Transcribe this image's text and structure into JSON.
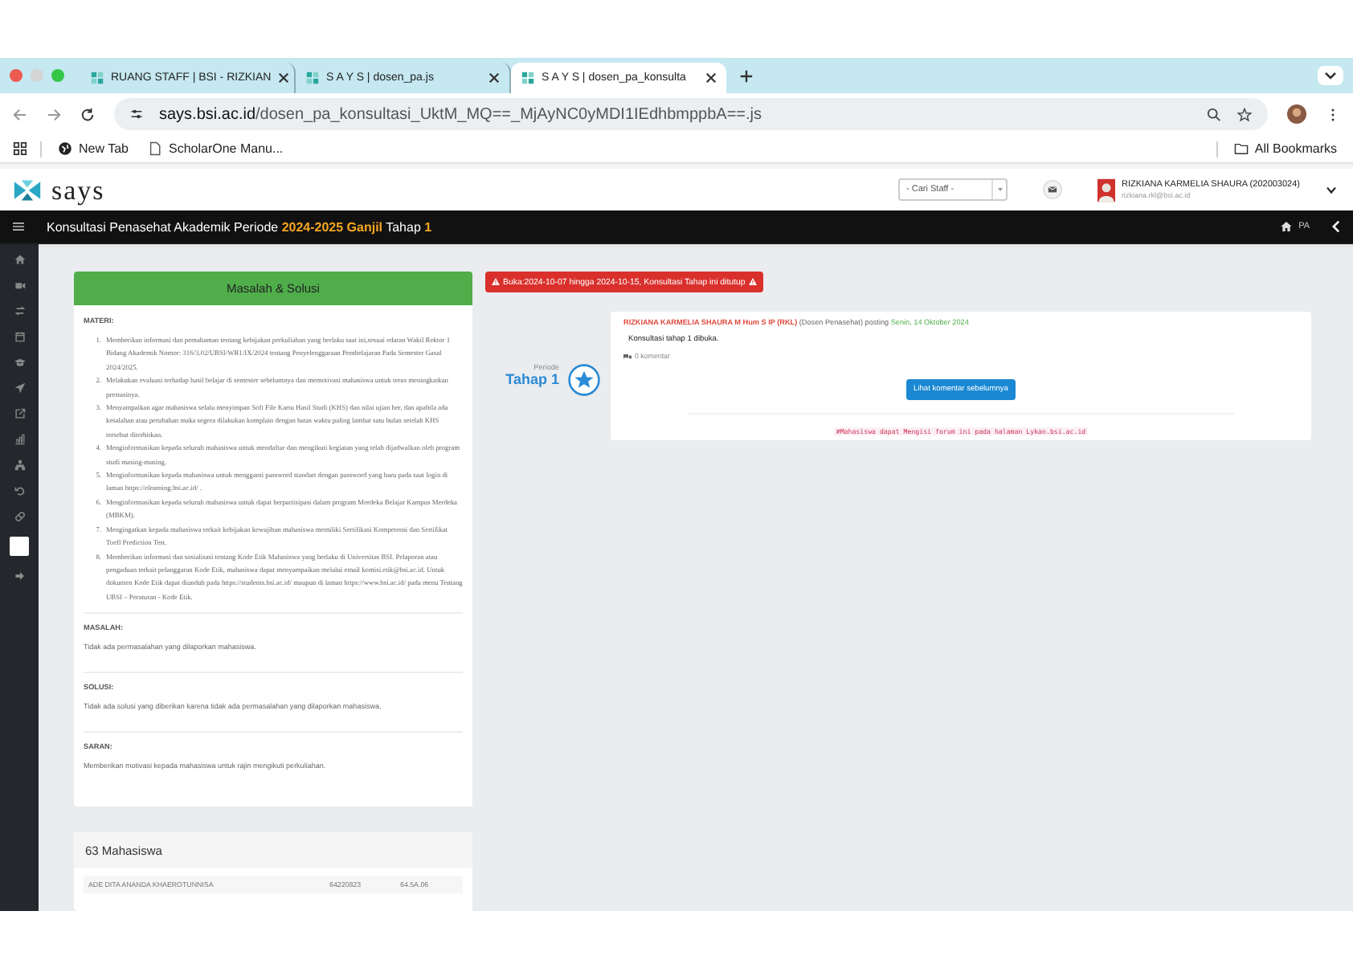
{
  "browser": {
    "tabs": [
      {
        "title": "RUANG STAFF | BSI - RIZKIAN",
        "selected": false
      },
      {
        "title": "S A Y S | dosen_pa.js",
        "selected": false
      },
      {
        "title": "S A Y S | dosen_pa_konsulta",
        "selected": true
      }
    ],
    "url_host": "says.bsi.ac.id",
    "url_path": "/dosen_pa_konsultasi_UktM_MQ==_MjAyNC0yMDI1IEdhbmppbA==.js",
    "bookmarks": [
      "New Tab",
      "ScholarOne Manu..."
    ],
    "all_bookmarks": "All Bookmarks"
  },
  "header": {
    "logo": "says",
    "staff_select": "- Cari Staff -",
    "user_name": "RIZKIANA KARMELIA SHAURA (202003024)",
    "user_email": "rizkiana.rkl@bsi.ac.id"
  },
  "title_bar": {
    "title": "Konsultasi Penasehat Akademik Periode **2024-2025 Ganjil** Tahap **1**",
    "breadcrumb": "PA"
  },
  "panel": {
    "title": "Masalah & Solusi",
    "sections": [
      {
        "kind": "list",
        "heading": "MATERI:",
        "items": [
          {
            "number": "1.",
            "text": "Memberikan informasi dan pemahaman tentang kebijakan perkuliahan yang berlaku saat ini,sesuai edaran Wakil Rektor 1 Bidang Akademik Nomor: 316/3.02/UBSI/WR1/IX/2024 tentang Penyelenggaraan Pembelajaran Pada Semester Gasal 2024/2025."
          },
          {
            "number": "2.",
            "text": "Melakukan evaluasi terhadap hasil belajar di semester sebelumnya dan memotivasi mahasiswa untuk terus meningkatkan prestasinya."
          },
          {
            "number": "3.",
            "text": "Menyampaikan agar mahasiswa selalu menyimpan Soft File Kartu Hasil Studi (KHS) dan nilai ujian her, dan apabila ada kesalahan atau perubahan maka segera dilakukan komplain dengan batas waktu paling lambat satu bulan setelah KHS tersebut diterbitkan."
          },
          {
            "number": "4.",
            "text": "Menginformasikan kepada seluruh mahasiswa untuk mendaftar dan mengikuti kegiatan yang telah dijadwalkan oleh program studi masing-masing."
          },
          {
            "number": "5.",
            "text": "Menginformasikan kepada mahasiswa untuk mengganti password standart dengan password yang baru pada saat login di laman https://elearning.bsi.ac.id/ ."
          },
          {
            "number": "6.",
            "text": "Menginformasikan kepada seluruh mahasiswa untuk dapat berpartisipasi dalam program Merdeka Belajar Kampus Merdeka (MBKM)."
          },
          {
            "number": "7.",
            "text": "Mengingatkan kepada mahasiswa terkait kebijakan kewajiban mahasiswa memiliki Sertifikasi Kompetensi dan Sertifikat Toefl Prediction Test."
          },
          {
            "number": "8.",
            "text": "Memberikan informasi dan sosialisasi tentang Kode Etik Mahasiswa yang berlaku di Universitas BSI. Pelaporan atau pengaduan terkait pelanggaran Kode Etik, mahasiswa dapat menyampaikan melalui email komisi.etik@bsi.ac.id. Untuk dokumen Kode Etik dapat diunduh pada https://students.bsi.ac.id/ maupun di laman https://www.bsi.ac.id/ pada menu Tentang UBSI – Peraturan - Kode Etik."
          }
        ]
      },
      {
        "kind": "text",
        "heading": "MASALAH:",
        "text": "Tidak ada permasalahan yang dilaporkan mahasiswa."
      },
      {
        "kind": "text",
        "heading": "SOLUSI:",
        "text": "Tidak ada solusi yang diberikan karena tidak ada permasalahan yang dilaporkan mahasiswa."
      },
      {
        "kind": "text",
        "heading": "SARAN:",
        "text": "Memberikan motivasi kepada mahasiswa untuk rajin mengikuti perkuliahan."
      }
    ]
  },
  "students": {
    "title": "63 Mahasiswa",
    "rows": [
      {
        "name": "ADE DITA ANANDA KHAEROTUNNISA",
        "nim": "64220823",
        "class": "64.5A.06"
      }
    ]
  },
  "alert": "Buka:2024-10-07 hingga 2024-10-15, Konsultasi Tahap ini ditutup",
  "timeline": {
    "period_label": "Periode",
    "stage": "Tahap 1",
    "post": {
      "author": "RIZKIANA KARMELIA SHAURA M Hum S IP (RKL)",
      "role": "(Dosen Penasehat) posting",
      "date": "Senin, 14 Oktober 2024",
      "message": "Konsultasi tahap 1 dibuka.",
      "comments": "0 komentar",
      "button": "Lihat komentar sebelumnya",
      "note": "#Mahasiswa dapat Mengisi forum ini pada halaman Lykan.bsi.ac.id"
    }
  }
}
